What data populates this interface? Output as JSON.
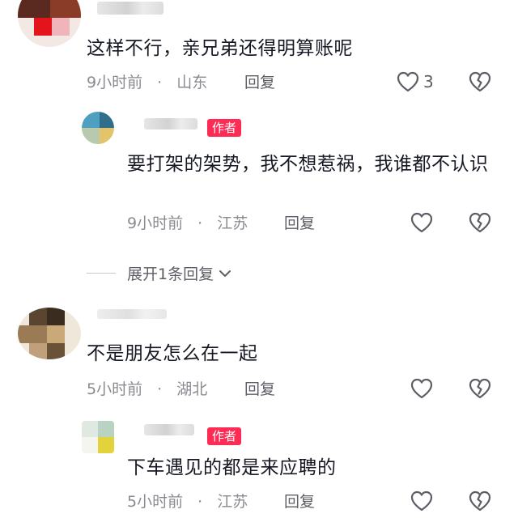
{
  "comments": [
    {
      "content": "这样不行，亲兄弟还得明算账呢",
      "time": "9小时前",
      "location": "山东",
      "reply_label": "回复",
      "likes": "3"
    },
    {
      "badge": "作者",
      "content": "要打架的架势，我不想惹祸，我谁都不认识",
      "time": "9小时前",
      "location": "江苏",
      "reply_label": "回复"
    },
    {
      "content": "不是朋友怎么在一起",
      "time": "5小时前",
      "location": "湖北",
      "reply_label": "回复"
    },
    {
      "badge": "作者",
      "content": "下车遇见的都是来应聘的",
      "time": "5小时前",
      "location": "江苏",
      "reply_label": "回复"
    }
  ],
  "expand_replies": "展开1条回复",
  "separator": "·",
  "icons": {
    "like": "heart-outline-icon",
    "dislike": "broken-heart-icon",
    "expand": "chevron-down-icon"
  },
  "colors": {
    "author_badge": "#fe2c55",
    "meta_text": "#8a8b91",
    "content_text": "#161823"
  }
}
